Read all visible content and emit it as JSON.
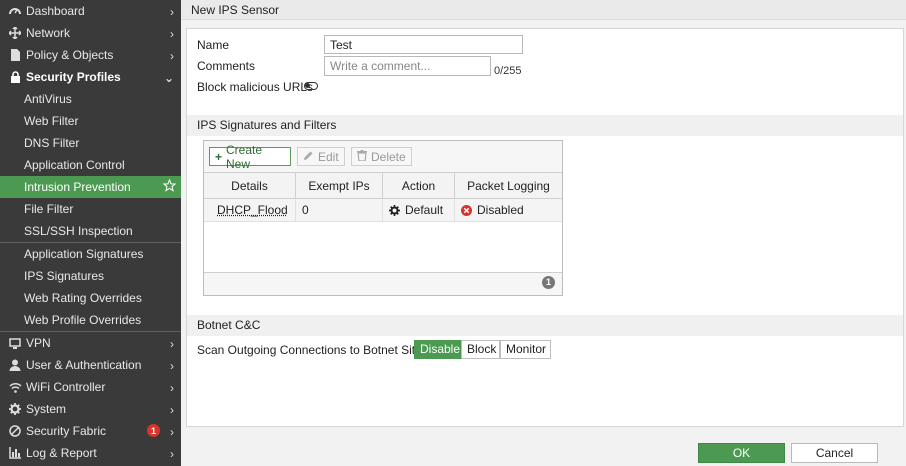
{
  "sidebar": {
    "items": [
      {
        "label": "Dashboard",
        "icon": "dashboard-icon"
      },
      {
        "label": "Network",
        "icon": "network-icon"
      },
      {
        "label": "Policy & Objects",
        "icon": "policy-icon"
      },
      {
        "label": "Security Profiles",
        "icon": "lock-icon"
      }
    ],
    "sub_items": [
      "AntiVirus",
      "Web Filter",
      "DNS Filter",
      "Application Control",
      "Intrusion Prevention",
      "File Filter",
      "SSL/SSH Inspection"
    ],
    "sub_items2": [
      "Application Signatures",
      "IPS Signatures",
      "Web Rating Overrides",
      "Web Profile Overrides"
    ],
    "bottom_items": [
      {
        "label": "VPN",
        "icon": "vpn-icon"
      },
      {
        "label": "User & Authentication",
        "icon": "user-icon"
      },
      {
        "label": "WiFi Controller",
        "icon": "wifi-icon"
      },
      {
        "label": "System",
        "icon": "gear-icon"
      },
      {
        "label": "Security Fabric",
        "icon": "fabric-icon",
        "badge": "1"
      },
      {
        "label": "Log & Report",
        "icon": "chart-icon"
      }
    ]
  },
  "page": {
    "title": "New IPS Sensor"
  },
  "form": {
    "name_label": "Name",
    "name_value": "Test",
    "comments_label": "Comments",
    "comments_placeholder": "Write a comment...",
    "comments_counter": "0/255",
    "block_label": "Block malicious URLs"
  },
  "ips": {
    "section_title": "IPS Signatures and Filters",
    "create_label": "Create New",
    "edit_label": "Edit",
    "delete_label": "Delete",
    "columns": [
      "Details",
      "Exempt IPs",
      "Action",
      "Packet Logging"
    ],
    "row": {
      "details": "DHCP_Flood",
      "exempt": "0",
      "action": "Default",
      "logging": "Disabled"
    },
    "count": "1"
  },
  "botnet": {
    "section_title": "Botnet C&C",
    "scan_label": "Scan Outgoing Connections to Botnet Sites",
    "options": [
      "Disable",
      "Block",
      "Monitor"
    ],
    "selected": "Disable"
  },
  "footer": {
    "ok_label": "OK",
    "cancel_label": "Cancel"
  },
  "colors": {
    "accent": "#4c9a52",
    "sidebar_bg": "#3a3a3a",
    "error": "#d9342b"
  }
}
